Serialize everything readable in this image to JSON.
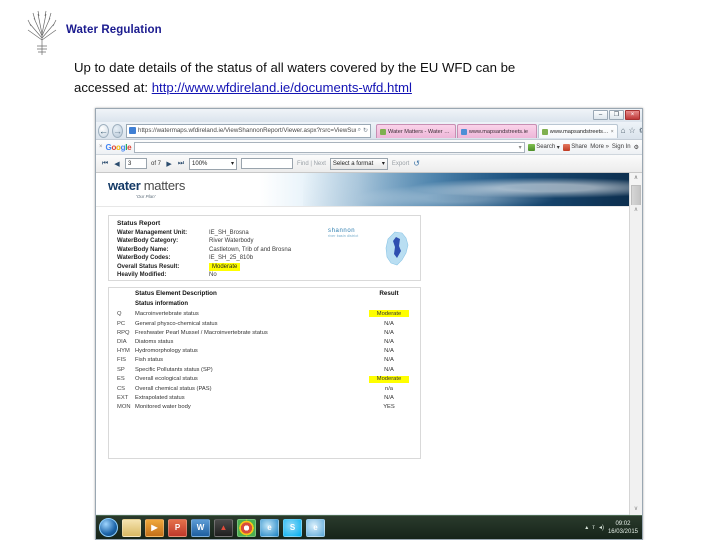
{
  "slide": {
    "title": "Water Regulation",
    "body_line1": "Up to date details of the status of all waters covered by the EU WFD can be",
    "body_line2_prefix": "accessed at: ",
    "body_link": "http://www.wfdireland.ie/documents-wfd.html"
  },
  "browser": {
    "window_controls": {
      "minimize": "–",
      "maximize": "❐",
      "close": "×"
    },
    "back_icon": "←",
    "forward_icon": "→",
    "address": "https://watermaps.wfdireland.ie/ViewShannonReport/Viewer.aspx?rsrc=ViewSummaryBody",
    "address_search_icon": "⌕",
    "address_refresh_icon": "↻",
    "tabs": [
      {
        "label": "Water Matters - Water Ma...",
        "active": false
      },
      {
        "label": "www.mapsandstreets.ie",
        "active": false
      },
      {
        "label": "www.mapsandstreets.ie",
        "active": true,
        "close": "×"
      }
    ],
    "chrome_icons": [
      "home-icon",
      "favorites-icon",
      "tools-icon"
    ]
  },
  "google_toolbar": {
    "close_icon": "×",
    "logo": "Google",
    "search_value": "",
    "dropdown_icon": "▾",
    "search_label": "Search",
    "share_label": "Share",
    "more_label": "More »",
    "signin_label": "Sign In"
  },
  "report_toolbar": {
    "first_icon": "⏮",
    "prev_icon": "◀",
    "page_value": "3",
    "of_label": "of 7",
    "next_icon": "▶",
    "last_icon": "⏭",
    "zoom_value": "100%",
    "zoom_caret": "▾",
    "find_value": "",
    "find_label": "Find | Next",
    "format_label": "Select a format",
    "format_caret": "▾",
    "export_label": "Export",
    "refresh_icon": "↺"
  },
  "report": {
    "logo_bold": "water",
    "logo_light": " matters",
    "logo_tagline": "'Our Plan'",
    "basin_logo_name": "shannon",
    "basin_logo_sub": "river basin district",
    "status_card": {
      "title": "Status Report",
      "fields": [
        {
          "label": "Water Management Unit:",
          "value": "IE_SH_Brosna",
          "highlight": false
        },
        {
          "label": "WaterBody Category:",
          "value": "River Waterbody",
          "highlight": false
        },
        {
          "label": "WaterBody Name:",
          "value": "Castletown, Trib of and Brosna",
          "highlight": false
        },
        {
          "label": "WaterBody Codes:",
          "value": "IE_SH_25_810b",
          "highlight": false
        },
        {
          "label": "Overall Status Result:",
          "value": "Moderate",
          "highlight": true
        },
        {
          "label": "Heavily Modified:",
          "value": "No",
          "highlight": false
        }
      ]
    },
    "element_table": {
      "header_desc": "Status Element Description",
      "header_result": "Result",
      "subheader": "Status information",
      "rows": [
        {
          "code": "Q",
          "desc": "Macroinvertebrate status",
          "result": "Moderate",
          "highlight": true
        },
        {
          "code": "PC",
          "desc": "General physco-chemical status",
          "result": "N/A",
          "highlight": false
        },
        {
          "code": "RPQ",
          "desc": "Freshwater Pearl Mussel / Macroinvertebrate status",
          "result": "N/A",
          "highlight": false
        },
        {
          "code": "DIA",
          "desc": "Diatoms status",
          "result": "N/A",
          "highlight": false
        },
        {
          "code": "HYM",
          "desc": "Hydromorphology status",
          "result": "N/A",
          "highlight": false
        },
        {
          "code": "FIS",
          "desc": "Fish status",
          "result": "N/A",
          "highlight": false
        },
        {
          "code": "SP",
          "desc": "Specific Pollutants status (SP)",
          "result": "N/A",
          "highlight": false
        },
        {
          "code": "ES",
          "desc": "Overall ecological status",
          "result": "Moderate",
          "highlight": true
        },
        {
          "code": "CS",
          "desc": "Overall chemical status (PAS)",
          "result": "n/a",
          "highlight": false
        },
        {
          "code": "EXT",
          "desc": "Extrapolated status",
          "result": "N/A",
          "highlight": false
        },
        {
          "code": "MON",
          "desc": "Monitored water body",
          "result": "YES",
          "highlight": false
        }
      ]
    },
    "scroll_up_icon": "∧",
    "scroll_down_icon": "∨"
  },
  "taskbar": {
    "start_label": "start-orb",
    "items": [
      {
        "name": "windows-explorer-icon",
        "glyph": ""
      },
      {
        "name": "media-player-icon",
        "glyph": "▶"
      },
      {
        "name": "powerpoint-icon",
        "glyph": "P"
      },
      {
        "name": "word-icon",
        "glyph": "W"
      },
      {
        "name": "adobe-reader-icon",
        "glyph": "▲"
      },
      {
        "name": "chrome-icon",
        "glyph": ""
      },
      {
        "name": "internet-explorer-icon",
        "glyph": "e"
      },
      {
        "name": "skype-icon",
        "glyph": "S"
      },
      {
        "name": "internet-explorer-2-icon",
        "glyph": "e"
      }
    ],
    "tray": {
      "show_hidden": "▴",
      "network": "ᴛ",
      "volume": "◂)"
    },
    "clock_time": "09:02",
    "clock_date": "16/03/2015"
  }
}
